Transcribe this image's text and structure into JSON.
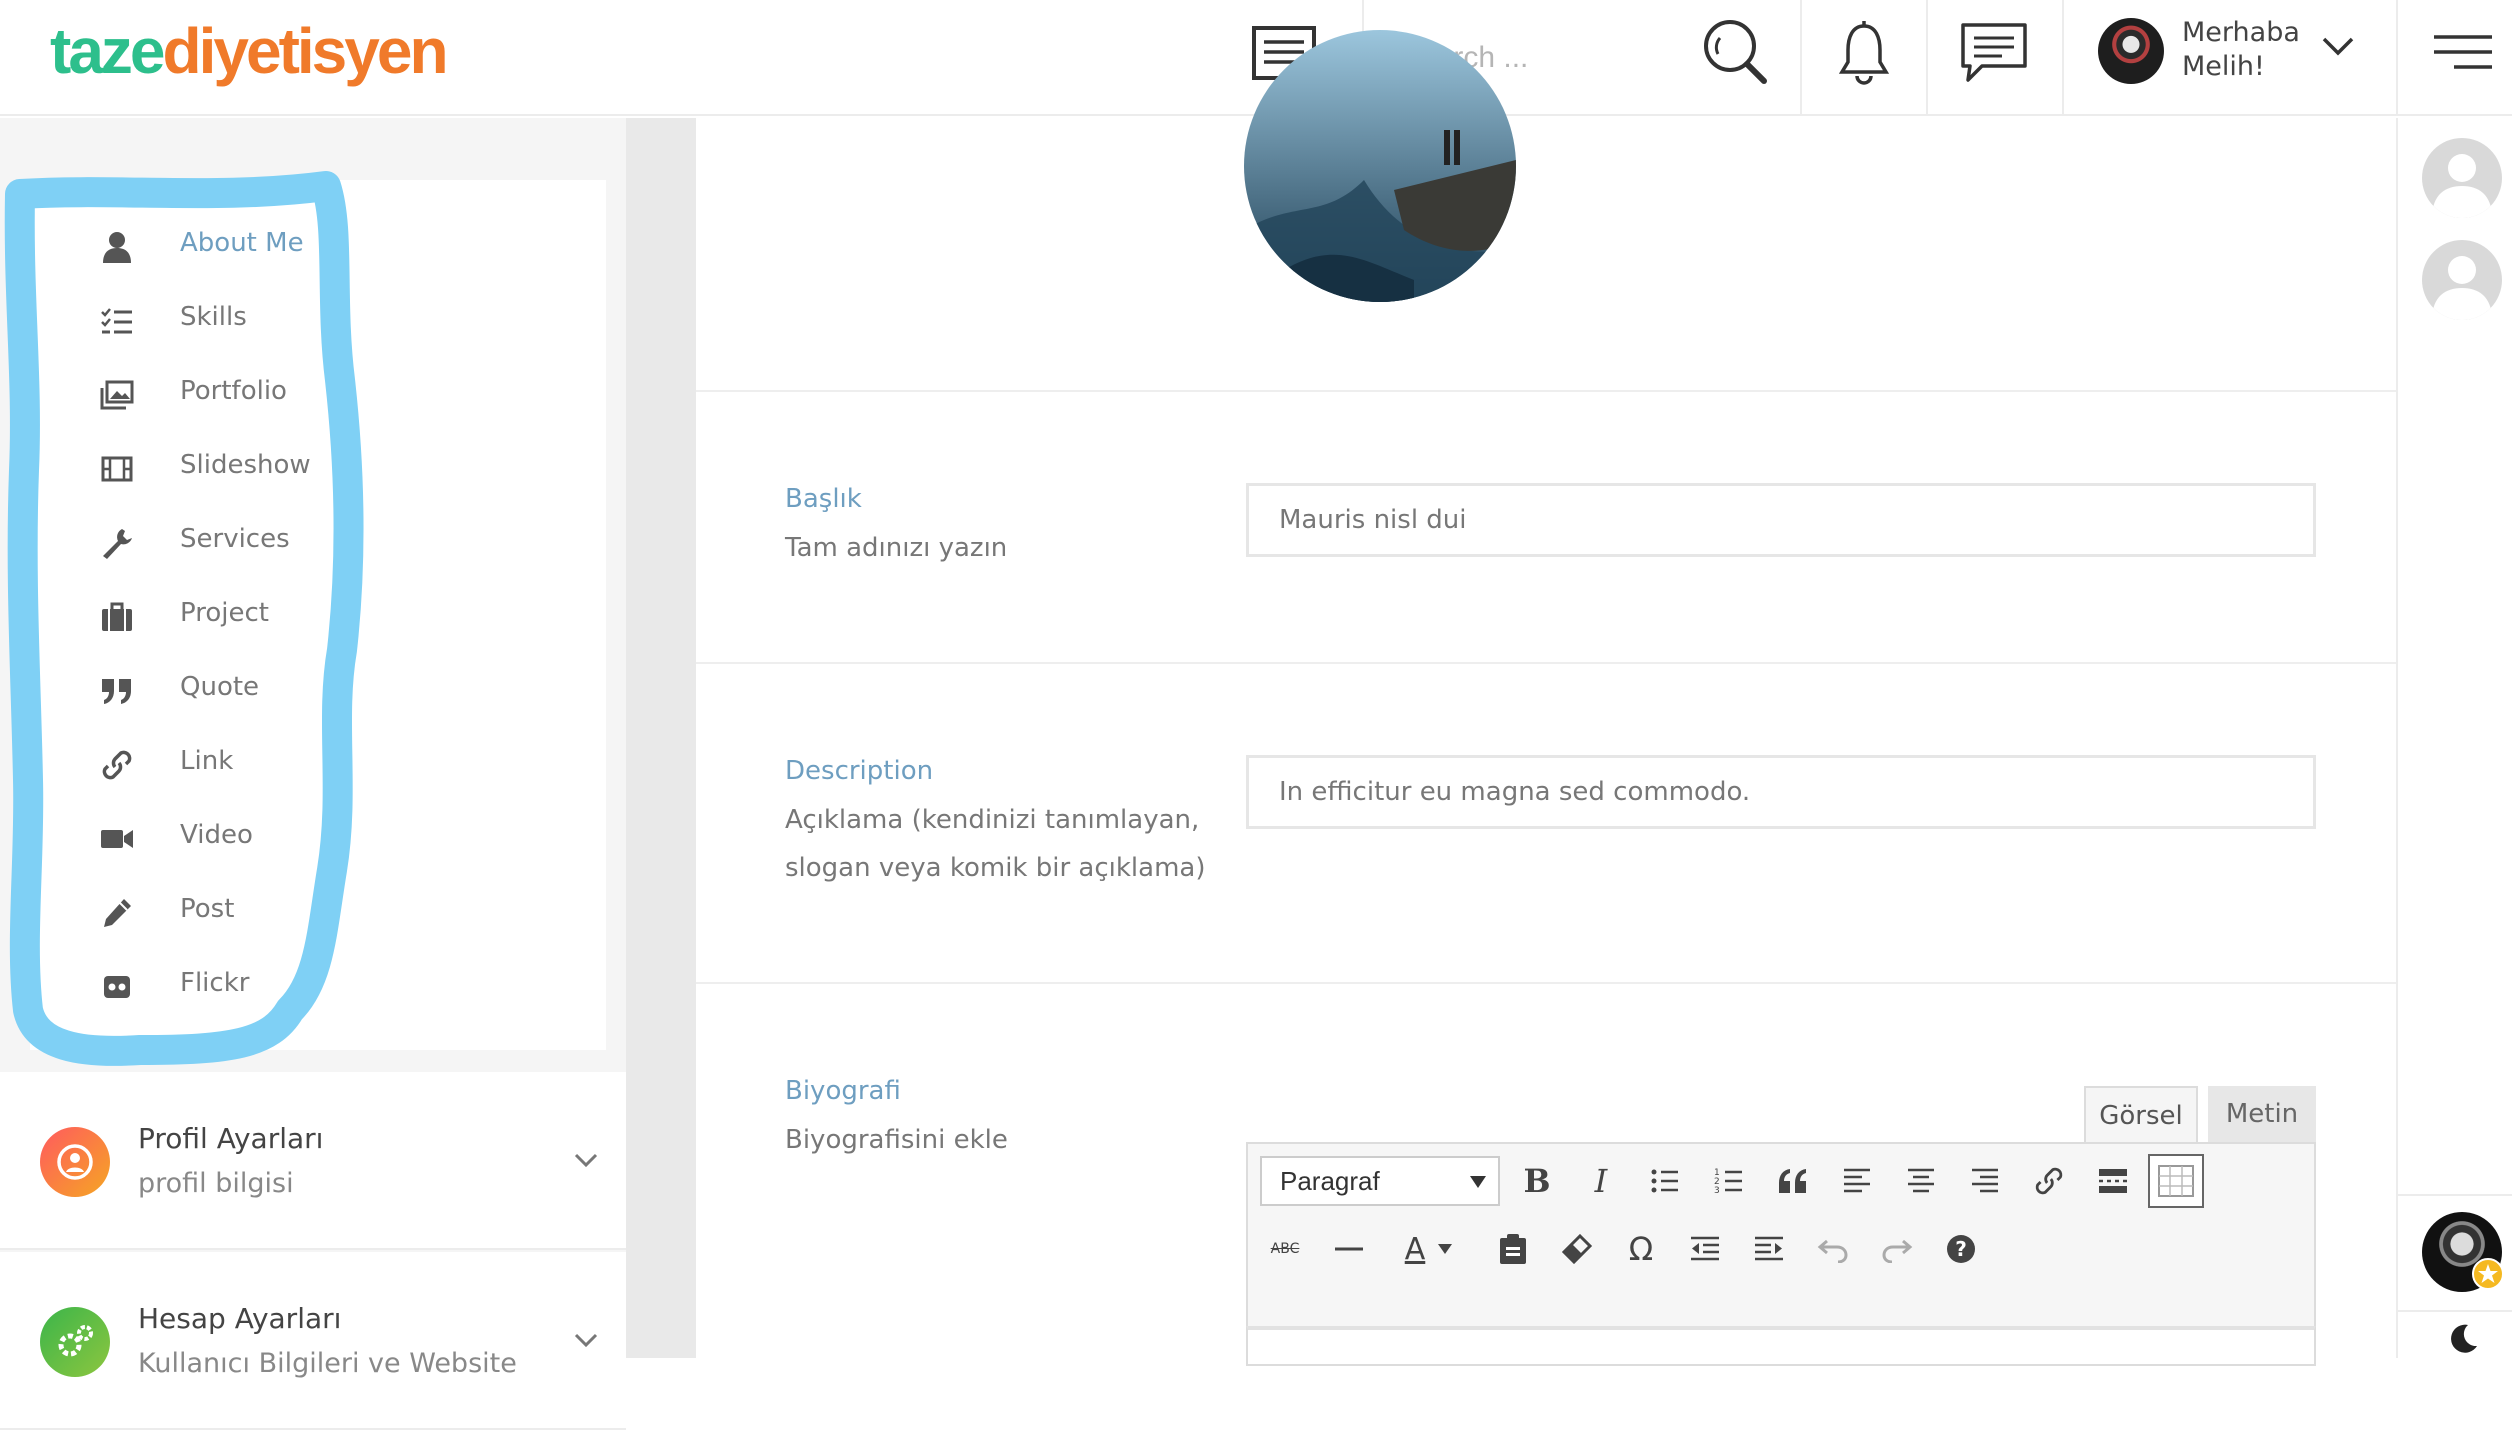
{
  "brand": {
    "part1": "taze",
    "part2": "diyetisyen",
    "color1": "#2dbf8c",
    "color2": "#f07a2a"
  },
  "header": {
    "search_placeholder": "Search ...",
    "greeting_line1": "Merhaba",
    "greeting_line2": "Melih!",
    "icons": [
      "list-icon",
      "search-icon",
      "bell-icon",
      "chat-icon",
      "chevron-down-icon",
      "hamburger-icon"
    ]
  },
  "sidebar": {
    "menu": [
      {
        "label": "About Me",
        "icon": "user-icon",
        "active": true
      },
      {
        "label": "Skills",
        "icon": "checklist-icon"
      },
      {
        "label": "Portfolio",
        "icon": "images-icon"
      },
      {
        "label": "Slideshow",
        "icon": "film-icon"
      },
      {
        "label": "Services",
        "icon": "wrench-icon"
      },
      {
        "label": "Project",
        "icon": "briefcase-icon"
      },
      {
        "label": "Quote",
        "icon": "quote-icon"
      },
      {
        "label": "Link",
        "icon": "link-icon"
      },
      {
        "label": "Video",
        "icon": "video-icon"
      },
      {
        "label": "Post",
        "icon": "pencil-icon"
      },
      {
        "label": "Flickr",
        "icon": "flickr-icon"
      }
    ],
    "highlight_color": "#7fd0f5",
    "accordions": [
      {
        "title": "Profil Ayarları",
        "subtitle": "profil bilgisi"
      },
      {
        "title": "Hesap Ayarları",
        "subtitle": "Kullanıcı Bilgileri ve Website"
      }
    ]
  },
  "form": {
    "title": {
      "label": "Başlık",
      "help": "Tam adınızı yazın",
      "value": "Mauris nisl dui"
    },
    "description": {
      "label": "Description",
      "help_line1": "Açıklama (kendinizi tanımlayan,",
      "help_line2": "slogan veya komik bir açıklama)",
      "value": "In efficitur eu magna sed commodo."
    },
    "bio": {
      "label": "Biyografi",
      "help": "Biyografisini ekle",
      "tab_visual": "Görsel",
      "tab_text": "Metin",
      "format_select": "Paragraf",
      "toolbar_row1": [
        "bold-icon",
        "italic-icon",
        "bullet-list-icon",
        "numbered-list-icon",
        "blockquote-icon",
        "align-left-icon",
        "align-center-icon",
        "align-right-icon",
        "link-icon",
        "read-more-icon",
        "toolbar-toggle-icon"
      ],
      "toolbar_row2": [
        "strikethrough-icon",
        "horizontal-line-icon",
        "text-color-icon",
        "paste-text-icon",
        "clear-format-icon",
        "special-char-icon",
        "outdent-icon",
        "indent-icon",
        "undo-icon",
        "redo-icon",
        "help-icon"
      ]
    }
  },
  "accent_color": "#6e9ec0"
}
